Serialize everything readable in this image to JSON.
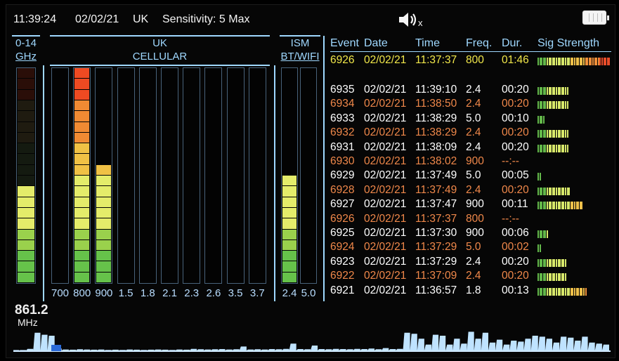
{
  "status": {
    "time": "11:39:24",
    "date": "02/02/21",
    "region": "UK",
    "sensitivity": "Sensitivity: 5 Max",
    "speaker_mute_glyph": "x",
    "icons": {
      "speaker": "speaker-muted-icon",
      "battery": "battery-full-icon"
    }
  },
  "bands": {
    "wide": {
      "header_top": "0-14",
      "header_bottom": "GHz"
    },
    "cellular": {
      "header_top": "UK",
      "header_bottom": "CELLULAR"
    },
    "ism": {
      "header_top": "ISM",
      "header_bottom": "BT/WIFI"
    }
  },
  "levels_total_segments": 20,
  "wide_level": 9,
  "cellular_bars": [
    {
      "label": "700",
      "level": 0
    },
    {
      "label": "800",
      "level": 20
    },
    {
      "label": "900",
      "level": 11
    },
    {
      "label": "1.5",
      "level": 0
    },
    {
      "label": "1.8",
      "level": 0
    },
    {
      "label": "2.1",
      "level": 0
    },
    {
      "label": "2.3",
      "level": 0
    },
    {
      "label": "2.6",
      "level": 0
    },
    {
      "label": "3.5",
      "level": 0
    },
    {
      "label": "3.7",
      "level": 0
    }
  ],
  "ism_bars": [
    {
      "label": "2.4",
      "level": 10
    },
    {
      "label": "5.0",
      "level": 0
    }
  ],
  "frequency": {
    "value": "861.2",
    "unit": "MHz"
  },
  "event_table": {
    "headers": {
      "event": "Event",
      "date": "Date",
      "time": "Time",
      "freq": "Freq.",
      "dur": "Dur.",
      "sig": "Sig Strength"
    },
    "highlight": {
      "event": "6926",
      "date": "02/02/21",
      "time": "11:37:37",
      "freq": "800",
      "dur": "01:46",
      "sig": 40,
      "color": "#f2e84a"
    },
    "rows": [
      {
        "event": "6935",
        "date": "02/02/21",
        "time": "11:39:10",
        "freq": "2.4",
        "dur": "00:20",
        "sig": 17,
        "color": "#ffffff"
      },
      {
        "event": "6934",
        "date": "02/02/21",
        "time": "11:38:50",
        "freq": "2.4",
        "dur": "00:20",
        "sig": 17,
        "color": "#f0884a"
      },
      {
        "event": "6933",
        "date": "02/02/21",
        "time": "11:38:29",
        "freq": "5.0",
        "dur": "00:10",
        "sig": 4,
        "color": "#ffffff"
      },
      {
        "event": "6932",
        "date": "02/02/21",
        "time": "11:38:29",
        "freq": "2.4",
        "dur": "00:20",
        "sig": 17,
        "color": "#f0884a"
      },
      {
        "event": "6931",
        "date": "02/02/21",
        "time": "11:38:09",
        "freq": "2.4",
        "dur": "00:20",
        "sig": 17,
        "color": "#ffffff"
      },
      {
        "event": "6930",
        "date": "02/02/21",
        "time": "11:38:02",
        "freq": "900",
        "dur": "--:--",
        "sig": 0,
        "color": "#f0884a"
      },
      {
        "event": "6929",
        "date": "02/02/21",
        "time": "11:37:49",
        "freq": "5.0",
        "dur": "00:05",
        "sig": 2,
        "color": "#ffffff"
      },
      {
        "event": "6928",
        "date": "02/02/21",
        "time": "11:37:49",
        "freq": "2.4",
        "dur": "00:20",
        "sig": 18,
        "color": "#f0884a"
      },
      {
        "event": "6927",
        "date": "02/02/21",
        "time": "11:37:47",
        "freq": "900",
        "dur": "00:11",
        "sig": 25,
        "color": "#ffffff"
      },
      {
        "event": "6926",
        "date": "02/02/21",
        "time": "11:37:37",
        "freq": "800",
        "dur": "--:--",
        "sig": 0,
        "color": "#f0884a"
      },
      {
        "event": "6925",
        "date": "02/02/21",
        "time": "11:37:30",
        "freq": "900",
        "dur": "00:06",
        "sig": 6,
        "color": "#ffffff"
      },
      {
        "event": "6924",
        "date": "02/02/21",
        "time": "11:37:29",
        "freq": "5.0",
        "dur": "00:02",
        "sig": 2,
        "color": "#f0884a"
      },
      {
        "event": "6923",
        "date": "02/02/21",
        "time": "11:37:29",
        "freq": "2.4",
        "dur": "00:20",
        "sig": 16,
        "color": "#ffffff"
      },
      {
        "event": "6922",
        "date": "02/02/21",
        "time": "11:37:09",
        "freq": "2.4",
        "dur": "00:20",
        "sig": 16,
        "color": "#f0884a"
      },
      {
        "event": "6921",
        "date": "02/02/21",
        "time": "11:36:57",
        "freq": "1.8",
        "dur": "00:13",
        "sig": 27,
        "color": "#ffffff"
      }
    ]
  },
  "spectrum": {
    "description_color": "#bfe3ff",
    "peaks": [
      0.02,
      0.02,
      0.08,
      0.9,
      0.8,
      0.75,
      0.1,
      0.05,
      0.04,
      0.06,
      0.05,
      0.04,
      0.05,
      0.03,
      0.04,
      0.03,
      0.05,
      0.04,
      0.03,
      0.04,
      0.05,
      0.04,
      0.03,
      0.05,
      0.04,
      0.08,
      0.06,
      0.05,
      0.06,
      0.07,
      0.05,
      0.06,
      0.2,
      0.05,
      0.06,
      0.05,
      0.07,
      0.06,
      0.08,
      0.35,
      0.07,
      0.06,
      0.25,
      0.07,
      0.06,
      0.08,
      0.07,
      0.06,
      0.08,
      0.07,
      0.1,
      0.06,
      0.12,
      0.07,
      0.08,
      0.9,
      0.85,
      0.6,
      0.3,
      0.8,
      0.75,
      0.3,
      0.6,
      0.35,
      0.95,
      0.6,
      0.9,
      0.4,
      0.55,
      0.3,
      0.5,
      0.45,
      0.6,
      0.75,
      0.7,
      0.6,
      0.4,
      0.7,
      0.65,
      0.5,
      0.7,
      0.4,
      0.35,
      0.3
    ],
    "marker_position": 0.08
  }
}
